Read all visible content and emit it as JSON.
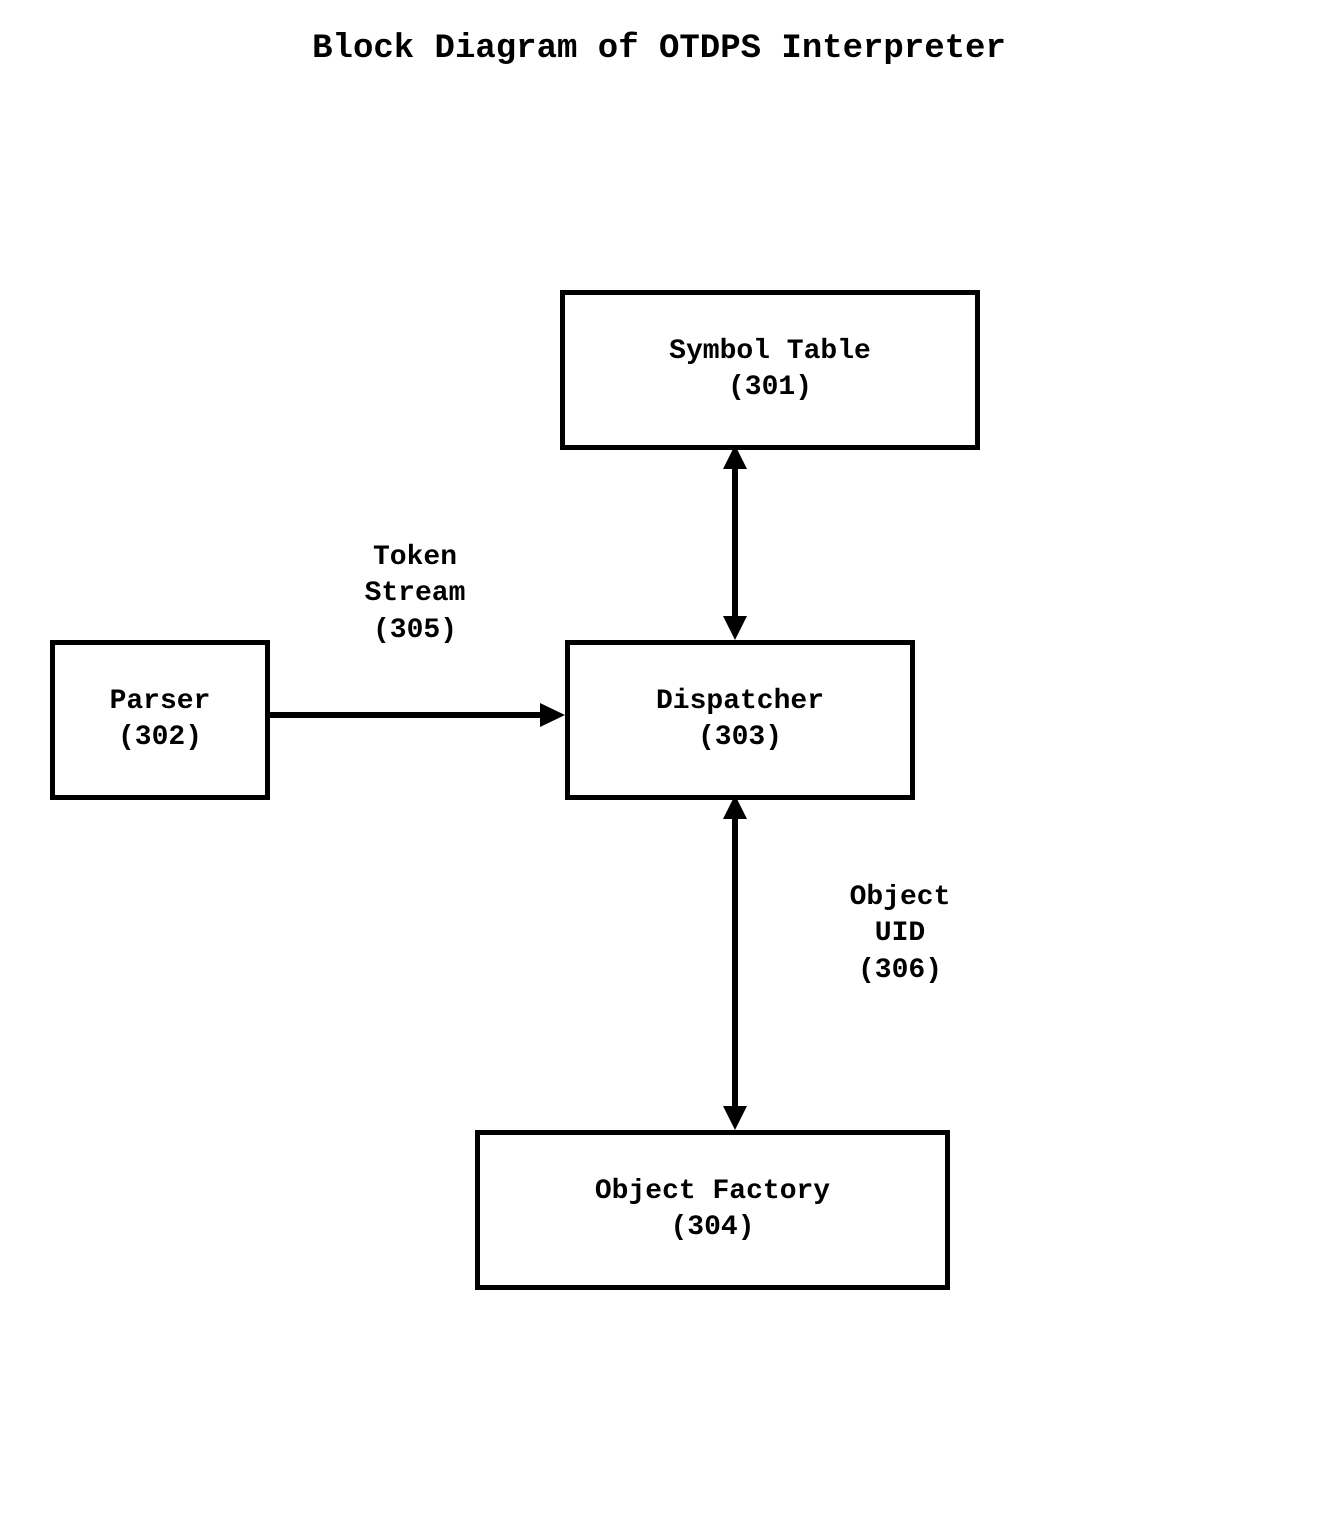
{
  "title": "Block Diagram of OTDPS Interpreter",
  "boxes": {
    "symbolTable": {
      "line1": "Symbol Table",
      "line2": "(301)"
    },
    "parser": {
      "line1": "Parser",
      "line2": "(302)"
    },
    "dispatcher": {
      "line1": "Dispatcher",
      "line2": "(303)"
    },
    "objectFactory": {
      "line1": "Object Factory",
      "line2": "(304)"
    }
  },
  "labels": {
    "tokenStream": {
      "line1": "Token",
      "line2": "Stream",
      "line3": "(305)"
    },
    "objectUID": {
      "line1": "Object",
      "line2": "UID",
      "line3": "(306)"
    }
  }
}
